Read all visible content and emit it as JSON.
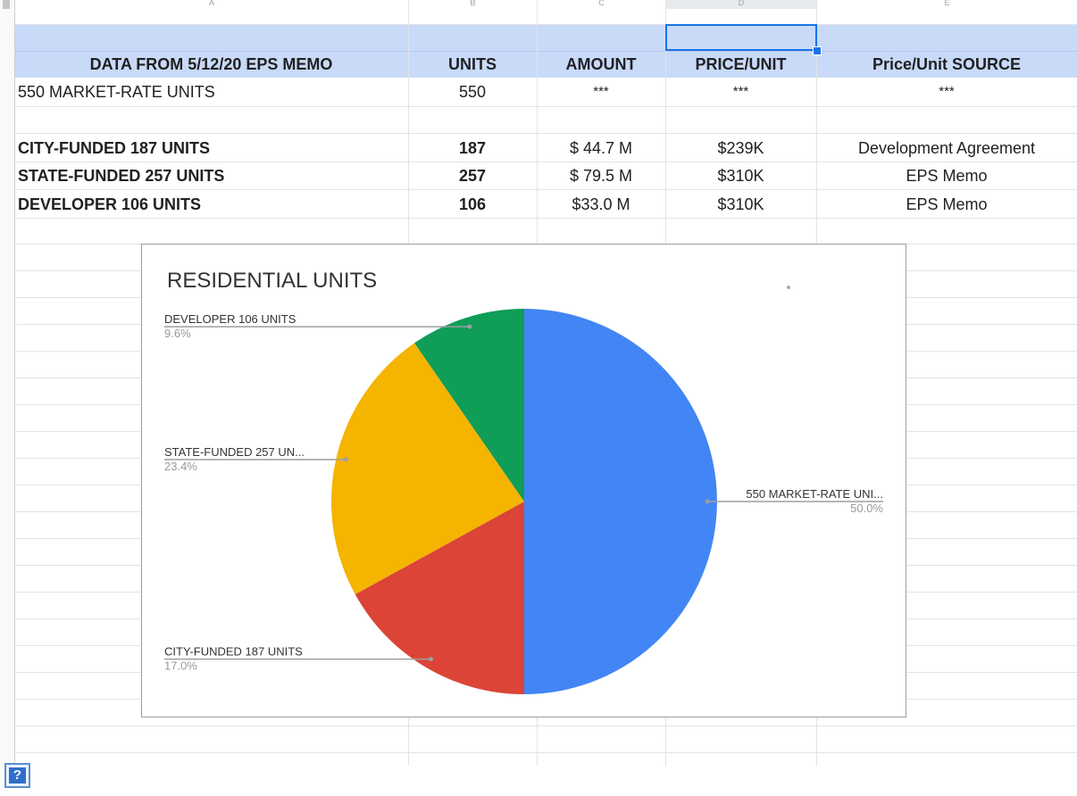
{
  "column_letters": [
    "A",
    "B",
    "C",
    "D",
    "E"
  ],
  "table": {
    "headers": [
      "DATA FROM 5/12/20 EPS MEMO",
      "UNITS",
      "AMOUNT",
      "PRICE/UNIT",
      "Price/Unit SOURCE"
    ],
    "rows": [
      {
        "label": "550 MARKET-RATE UNITS",
        "units": "550",
        "amount": "***",
        "price": "***",
        "source": "***"
      },
      {
        "label": "CITY-FUNDED 187 UNITS",
        "units": "187",
        "amount": "$ 44.7 M",
        "price": "$239K",
        "source": "Development Agreement"
      },
      {
        "label": "STATE-FUNDED 257 UNITS",
        "units": "257",
        "amount": "$ 79.5 M",
        "price": "$310K",
        "source": "EPS Memo"
      },
      {
        "label": "DEVELOPER 106 UNITS",
        "units": "106",
        "amount": "$33.0 M",
        "price": "$310K",
        "source": "EPS Memo"
      }
    ]
  },
  "chart_data": {
    "type": "pie",
    "title": "RESIDENTIAL UNITS",
    "slices": [
      {
        "name": "550 MARKET-RATE UNITS",
        "display_label": "550 MARKET-RATE UNI...",
        "value": 550,
        "percent_label": "50.0%",
        "color": "#4285f4"
      },
      {
        "name": "CITY-FUNDED 187 UNITS",
        "display_label": "CITY-FUNDED 187 UNITS",
        "value": 187,
        "percent_label": "17.0%",
        "color": "#db4437"
      },
      {
        "name": "STATE-FUNDED 257 UNITS",
        "display_label": "STATE-FUNDED 257 UN...",
        "value": 257,
        "percent_label": "23.4%",
        "color": "#f4b400"
      },
      {
        "name": "DEVELOPER 106 UNITS",
        "display_label": "DEVELOPER 106 UNITS",
        "value": 106,
        "percent_label": "9.6%",
        "color": "#0f9d58"
      }
    ]
  },
  "help_button": {
    "label": "?"
  }
}
